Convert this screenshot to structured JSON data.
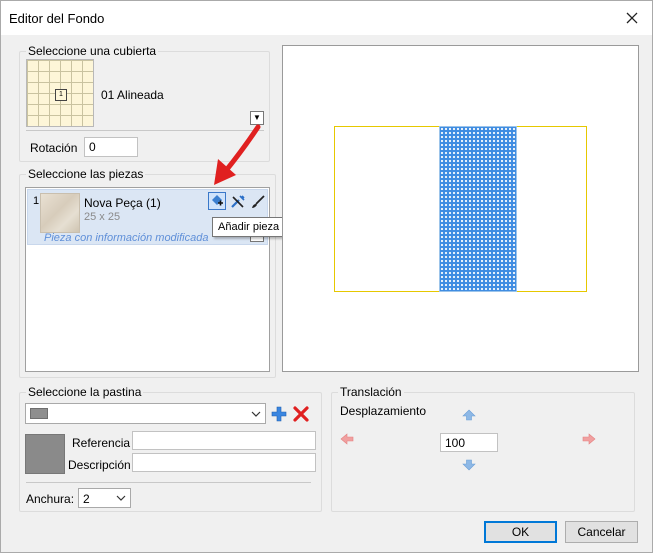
{
  "window": {
    "title": "Editor del Fondo"
  },
  "deck": {
    "group_label": "Seleccione una cubierta",
    "name": "01 Alineada",
    "tile_marker": "1",
    "rotation_label": "Rotación",
    "rotation_value": "0"
  },
  "pieces": {
    "group_label": "Seleccione las piezas",
    "items": [
      {
        "index": "1",
        "name": "Nova Peça (1)",
        "size": "25 x 25",
        "status": "Pieza con información modificada"
      }
    ],
    "tooltip": "Añadir pieza a la biblioteca"
  },
  "grout": {
    "group_label": "Seleccione la pastina",
    "selected_value": "",
    "reference_label": "Referencia",
    "reference_value": "",
    "description_label": "Descripción",
    "description_value": "",
    "width_label": "Anchura:",
    "width_value": "2"
  },
  "translation": {
    "group_label": "Translación",
    "offset_label": "Desplazamiento",
    "offset_value": "100"
  },
  "buttons": {
    "ok": "OK",
    "cancel": "Cancelar"
  },
  "colors": {
    "accent_red": "#e02020",
    "preview_fill": "#3f8ce2",
    "preview_border": "#e6c800",
    "selection": "#dbe6f4"
  },
  "icons": {
    "add_to_library": "add-to-library-icon",
    "tools": "wrench-icon",
    "brush": "brush-icon",
    "add_grout": "plus-icon",
    "delete_grout": "x-icon",
    "move_up": "arrow-up-icon",
    "move_down": "arrow-down-icon",
    "move_left": "arrow-left-icon",
    "move_right": "arrow-right-icon"
  }
}
